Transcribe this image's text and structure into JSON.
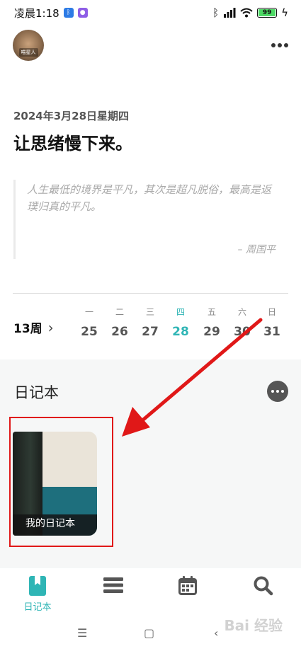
{
  "status_bar": {
    "time": "凌晨1:18",
    "battery": "99"
  },
  "header": {
    "avatar_caption": "喵星人"
  },
  "main": {
    "date": "2024年3月28日星期四",
    "headline": "让思绪慢下来。",
    "quote": "人生最低的境界是平凡，其次是超凡脱俗，最高是返璞归真的平凡。",
    "quote_author": "– 周国平"
  },
  "calendar": {
    "week_label": "13周",
    "days": [
      {
        "weekday": "一",
        "day": "25"
      },
      {
        "weekday": "二",
        "day": "26"
      },
      {
        "weekday": "三",
        "day": "27"
      },
      {
        "weekday": "四",
        "day": "28",
        "active": true
      },
      {
        "weekday": "五",
        "day": "29"
      },
      {
        "weekday": "六",
        "day": "30"
      },
      {
        "weekday": "日",
        "day": "31"
      }
    ]
  },
  "notebooks": {
    "section_title": "日记本",
    "items": [
      {
        "title": "我的日记本"
      }
    ]
  },
  "bottom_nav": {
    "items": [
      {
        "label": "日记本",
        "icon": "bookmark-icon",
        "active": true
      },
      {
        "label": "",
        "icon": "list-icon"
      },
      {
        "label": "",
        "icon": "calendar-icon"
      },
      {
        "label": "",
        "icon": "search-icon"
      }
    ]
  },
  "watermark": "Bai 经验",
  "colors": {
    "accent": "#2fb5b5",
    "annotation_red": "#e01818"
  }
}
